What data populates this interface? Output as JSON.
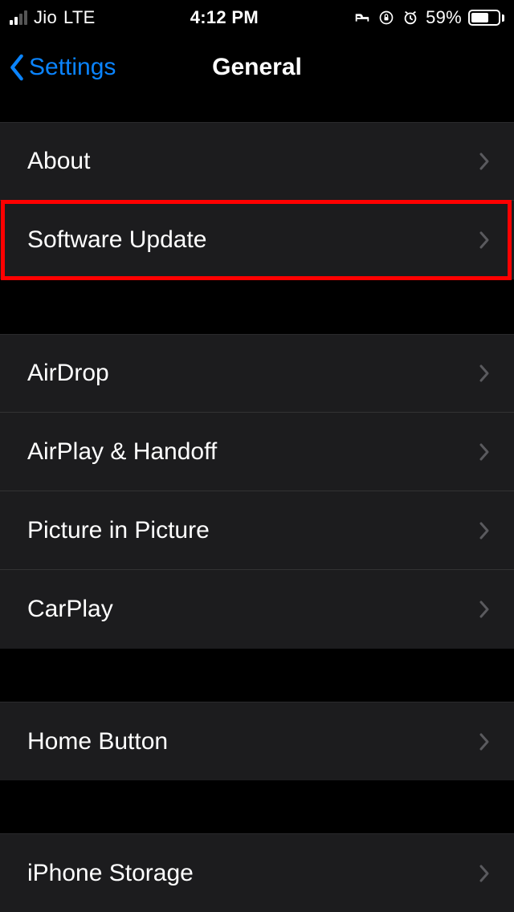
{
  "status": {
    "carrier": "Jio",
    "network": "LTE",
    "time": "4:12 PM",
    "battery_pct": "59%"
  },
  "nav": {
    "back_label": "Settings",
    "title": "General"
  },
  "groups": [
    {
      "items": [
        {
          "id": "about",
          "label": "About"
        },
        {
          "id": "software-update",
          "label": "Software Update",
          "highlighted": true
        }
      ]
    },
    {
      "items": [
        {
          "id": "airdrop",
          "label": "AirDrop"
        },
        {
          "id": "airplay-handoff",
          "label": "AirPlay & Handoff"
        },
        {
          "id": "picture-in-picture",
          "label": "Picture in Picture"
        },
        {
          "id": "carplay",
          "label": "CarPlay"
        }
      ]
    },
    {
      "items": [
        {
          "id": "home-button",
          "label": "Home Button"
        }
      ]
    },
    {
      "items": [
        {
          "id": "iphone-storage",
          "label": "iPhone Storage"
        }
      ]
    }
  ]
}
